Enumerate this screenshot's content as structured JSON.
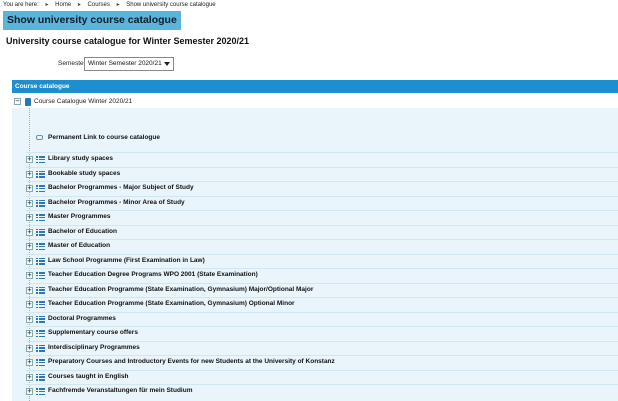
{
  "breadcrumb": {
    "prefix": "You are here:",
    "items": [
      "Home",
      "Courses",
      "Show university course catalogue"
    ]
  },
  "page_title": "Show university course catalogue",
  "heading": "University course catalogue for Winter Semester 2020/21",
  "semester": {
    "label": "Semester",
    "selected": "Winter Semester 2020/21"
  },
  "catalogue_header": "Course catalogue",
  "root": {
    "toggle": "−",
    "label": "Course Catalogue Winter 2020/21"
  },
  "permalink_label": "Permanent Link to course catalogue",
  "expand_symbol": "+",
  "items": [
    "Library study spaces",
    "Bookable study spaces",
    "Bachelor Programmes - Major Subject of Study",
    "Bachelor Programmes - Minor Area of Study",
    "Master Programmes",
    "Bachelor of Education",
    "Master of Education",
    "Law School Programme (First Examination in Law)",
    "Teacher Education Degree Programs WPO 2001 (State Examination)",
    "Teacher Education Programme (State Examination, Gymnasium) Major/Optional Major",
    "Teacher Education Programme (State Examination, Gymnasium) Optional Minor",
    "Doctoral Programmes",
    "Supplementary course offers",
    "Interdisciplinary Programmes",
    "Preparatory Courses and Introductory Events for new Students at the University of Konstanz",
    "Courses taught in English",
    "Fachfremde Veranstaltungen für mein Studium"
  ],
  "colors": {
    "title_bar": "#5bb4d9",
    "catalogue_header": "#1d8fd0",
    "tree_background": "#eaf5fb",
    "icon_blue": "#2a78b8"
  }
}
